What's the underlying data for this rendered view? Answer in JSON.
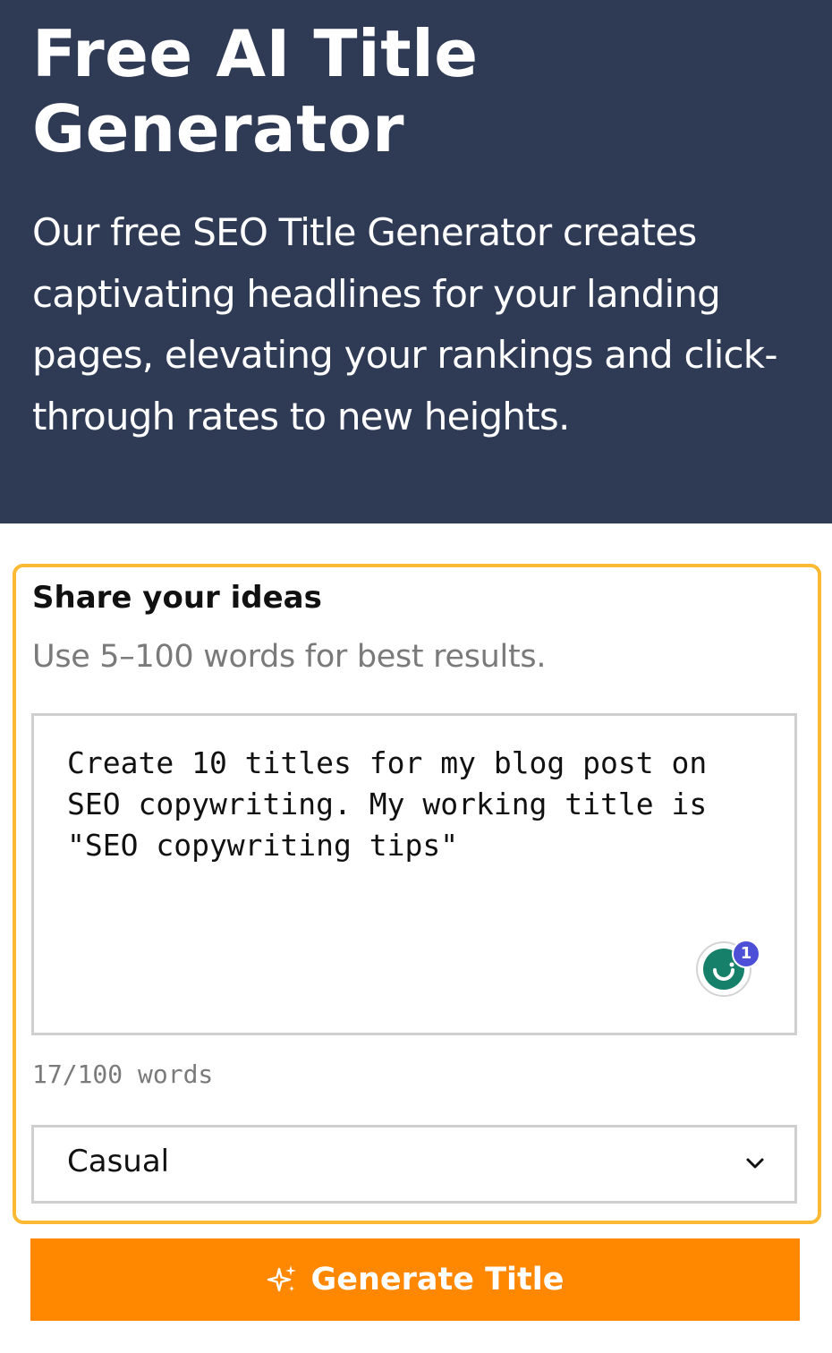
{
  "hero": {
    "title": "Free AI Title Generator",
    "description": "Our free SEO Title Generator creates captivating headlines for your landing pages, elevating your rankings and click-through rates to new heights."
  },
  "form": {
    "label": "Share your ideas",
    "hint": "Use 5–100 words for best results.",
    "input_value": "Create 10 titles for my blog post on SEO copywriting. My working title is \"SEO copywriting tips\"",
    "assistant_badge_count": "1",
    "word_count": "17/100 words",
    "tone_selected": "Casual"
  },
  "actions": {
    "generate_label": "Generate Title"
  },
  "colors": {
    "hero_bg": "#2f3b55",
    "card_border": "#fbb934",
    "button_bg": "#ff8800",
    "assistant_green": "#17806b",
    "badge_purple": "#4d4fd6"
  },
  "icons": {
    "assistant": "writing-assistant-icon",
    "dropdown": "chevron-down-icon",
    "button": "sparkle-icon"
  }
}
